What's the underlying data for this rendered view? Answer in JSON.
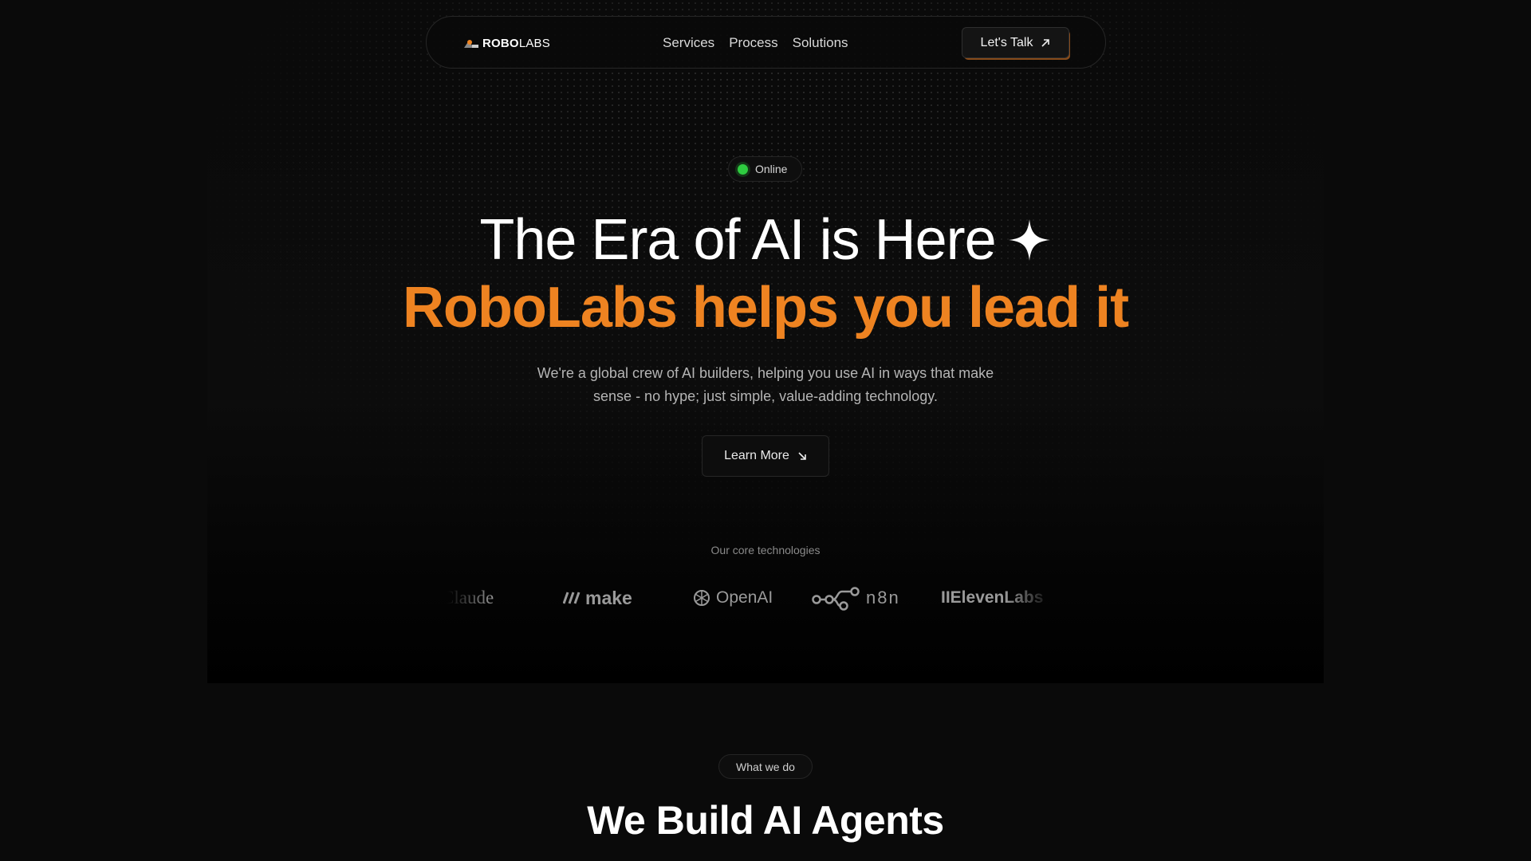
{
  "nav": {
    "logo_bold": "ROBO",
    "logo_light": "LABS",
    "links": [
      "Services",
      "Process",
      "Solutions"
    ],
    "cta_label": "Let's Talk"
  },
  "hero": {
    "status": "Online",
    "title": "The Era of AI is Here",
    "subtitle": "RoboLabs helps you lead it",
    "description": "We're a global crew of AI builders, helping you use AI in ways that make sense - no hype; just simple, value-adding technology.",
    "button_label": "Learn More"
  },
  "tech": {
    "label": "Our core technologies",
    "logos": [
      "Claude",
      "make",
      "OpenAI",
      "n8n",
      "IIElevenLabs"
    ]
  },
  "section2": {
    "pill": "What we do",
    "title": "We Build AI Agents"
  },
  "colors": {
    "accent": "#ee8321",
    "background": "#0a0a0a",
    "status_green": "#2ecc40"
  }
}
